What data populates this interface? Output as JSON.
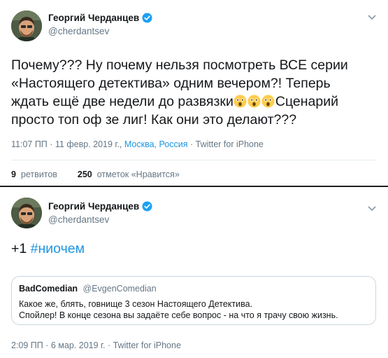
{
  "tweet1": {
    "author_name": "Георгий Черданцев",
    "author_handle": "@cherdantsev",
    "text_lines": [
      "Почему??? Ну почему нельзя посмотреть ВСЕ серии",
      "«Настоящего детектива» одним вечером?! Теперь",
      "ждать ещё две недели до развязки",
      "Сценарий",
      "просто топ оф зе лиг! Как они это делают???"
    ],
    "emoji_icon": "astonished-face-icon",
    "time": "11:07 ПП · 11 февр. 2019 г.,",
    "location": "Москва, Россия",
    "source": "· Twitter for iPhone",
    "retweets_count": "9",
    "retweets_label": "ретвитов",
    "likes_count": "250",
    "likes_label": "отметок «Нравится»"
  },
  "tweet2": {
    "author_name": "Георгий Черданцев",
    "author_handle": "@cherdantsev",
    "text_prefix": "+1",
    "hashtag": "#ниочем",
    "quote": {
      "author_name": "BadComedian",
      "author_handle": "@EvgenComedian",
      "line1": "Какое же, блять, говнище 3 сезон Настоящего Детектива.",
      "line2": "Спойлер! В конце сезона вы задаёте себе вопрос - на что я трачу свою жизнь."
    },
    "meta": "2:09 ПП · 6 мар. 2019 г. · Twitter for iPhone"
  },
  "colors": {
    "text": "#14171a",
    "muted": "#657786",
    "link": "#1b95e0",
    "verified": "#1da1f2"
  }
}
